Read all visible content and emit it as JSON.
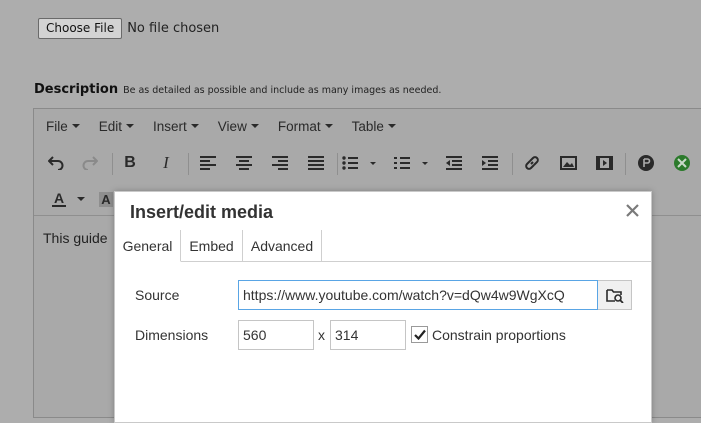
{
  "file_upload": {
    "button_label": "Choose File",
    "status": "No file chosen"
  },
  "description": {
    "title": "Description",
    "hint": "Be as detailed as possible and include as many images as needed."
  },
  "editor": {
    "menus": [
      {
        "label": "File"
      },
      {
        "label": "Edit"
      },
      {
        "label": "Insert"
      },
      {
        "label": "View"
      },
      {
        "label": "Format"
      },
      {
        "label": "Table"
      }
    ],
    "toolbar_icons": [
      "undo-icon",
      "redo-icon",
      "bold-icon",
      "italic-icon",
      "align-left-icon",
      "align-center-icon",
      "align-right-icon",
      "justify-icon",
      "bullet-list-icon",
      "numbered-list-icon",
      "outdent-icon",
      "indent-icon",
      "link-icon",
      "image-icon",
      "media-icon",
      "playstation-icon",
      "xbox-icon",
      "text-color-icon",
      "background-color-icon"
    ],
    "font_color_letter": "A",
    "bg_color_letter": "A",
    "content_text": "This guide"
  },
  "dialog": {
    "title": "Insert/edit media",
    "tabs": [
      {
        "label": "General",
        "active": true
      },
      {
        "label": "Embed",
        "active": false
      },
      {
        "label": "Advanced",
        "active": false
      }
    ],
    "source_label": "Source",
    "source_value": "https://www.youtube.com/watch?v=dQw4w9WgXcQ",
    "dimensions_label": "Dimensions",
    "width_value": "560",
    "x_separator": "x",
    "height_value": "314",
    "constrain_label": "Constrain proportions",
    "constrain_checked": true
  },
  "colors": {
    "overlay_bg": "#adadad",
    "focus_border": "#59a5e5",
    "xbox_green": "#2b7a2b"
  }
}
